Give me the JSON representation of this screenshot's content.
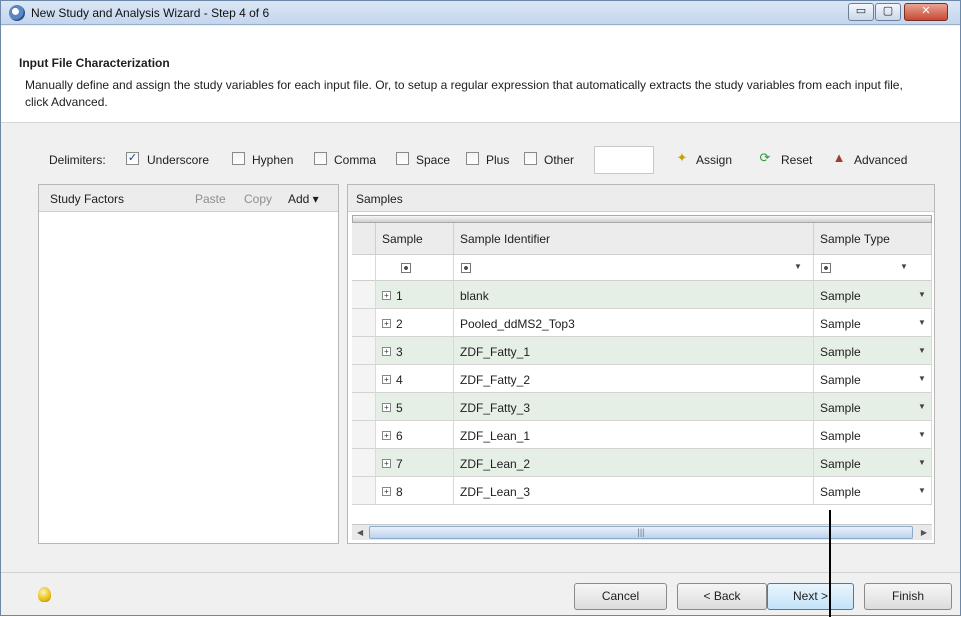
{
  "window": {
    "title": "New Study and Analysis Wizard - Step 4 of 6",
    "controls": {
      "minimize": "▭",
      "maximize": "▢",
      "close": "✕"
    }
  },
  "header": {
    "title": "Input File Characterization",
    "description": "Manually define and assign the study variables for each input file. Or, to setup a regular expression that automatically extracts the study variables from each input file, click Advanced."
  },
  "delimiters": {
    "label": "Delimiters:",
    "options": [
      {
        "label": "Underscore",
        "checked": true
      },
      {
        "label": "Hyphen",
        "checked": false
      },
      {
        "label": "Comma",
        "checked": false
      },
      {
        "label": "Space",
        "checked": false
      },
      {
        "label": "Plus",
        "checked": false
      },
      {
        "label": "Other",
        "checked": false
      }
    ],
    "other_value": ""
  },
  "toolbar": {
    "assign": "Assign",
    "reset": "Reset",
    "advanced": "Advanced"
  },
  "study_factors": {
    "title": "Study Factors",
    "paste": "Paste",
    "copy": "Copy",
    "add": "Add ▾"
  },
  "samples": {
    "title": "Samples",
    "columns": [
      "Sample",
      "Sample Identifier",
      "Sample Type"
    ],
    "rows": [
      {
        "sample": "1",
        "identifier": "blank",
        "type": "Sample"
      },
      {
        "sample": "2",
        "identifier": "Pooled_ddMS2_Top3",
        "type": "Sample"
      },
      {
        "sample": "3",
        "identifier": "ZDF_Fatty_1",
        "type": "Sample"
      },
      {
        "sample": "4",
        "identifier": "ZDF_Fatty_2",
        "type": "Sample"
      },
      {
        "sample": "5",
        "identifier": "ZDF_Fatty_3",
        "type": "Sample"
      },
      {
        "sample": "6",
        "identifier": "ZDF_Lean_1",
        "type": "Sample"
      },
      {
        "sample": "7",
        "identifier": "ZDF_Lean_2",
        "type": "Sample"
      },
      {
        "sample": "8",
        "identifier": "ZDF_Lean_3",
        "type": "Sample"
      }
    ]
  },
  "footer": {
    "cancel": "Cancel",
    "back": "< Back",
    "next": "Next >",
    "finish": "Finish"
  },
  "colors": {
    "row_alt": "#e5efe6",
    "title_bar": "#c3d6ee",
    "close_button": "#c74a33"
  }
}
